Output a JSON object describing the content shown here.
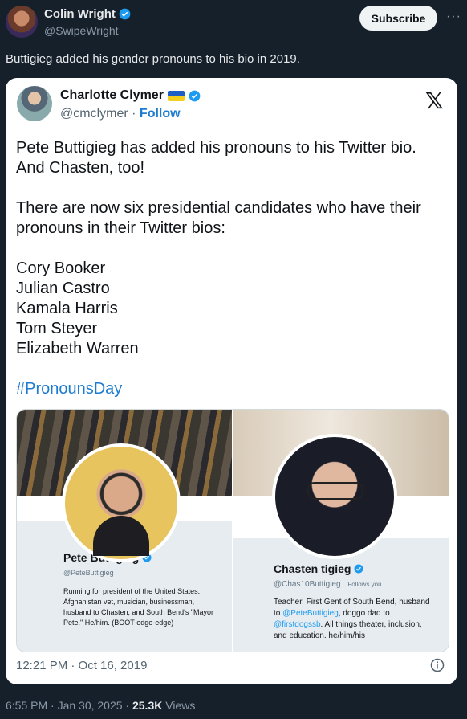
{
  "author": {
    "name": "Colin Wright",
    "handle": "@SwipeWright",
    "subscribe_label": "Subscribe",
    "more_label": "···"
  },
  "tweet": {
    "text": "Buttigieg added his gender pronouns to his bio in 2019."
  },
  "quoted": {
    "name": "Charlotte Clymer",
    "handle": "@cmclymer",
    "separator": "·",
    "follow_label": "Follow",
    "x_logo": "𝕏",
    "body_line1": "Pete Buttigieg has added his pronouns to his Twitter bio.\nAnd Chasten, too!",
    "body_line2": "There are now six presidential candidates who have their\npronouns in their Twitter bios:",
    "candidates": [
      "Cory Booker",
      "Julian Castro",
      "Kamala Harris",
      "Tom Steyer",
      "Elizabeth Warren"
    ],
    "hashtag": "#PronounsDay",
    "timestamp": "12:21 PM · Oct 16, 2019",
    "profiles": [
      {
        "name": "Pete Buttigieg",
        "handle": "@PeteButtigieg",
        "bio": "Running for president of the United States. Afghanistan vet, musician, businessman, husband to Chasten, and South Bend's \"Mayor Pete.\" He/him. (BOOT-edge-edge)"
      },
      {
        "name": "Chasten  tigieg",
        "handle": "@Chas10Buttigieg",
        "follows_you": "Follows you",
        "bio_a": "Teacher, First Gent of South Bend, husband to ",
        "bio_link1": "@PeteButtigieg",
        "bio_b": ", doggo dad to ",
        "bio_link2": "@firstdogssb",
        "bio_c": ". All things theater, inclusion, and education. he/him/his"
      }
    ]
  },
  "footer": {
    "time": "6:55 PM · Jan 30, 2025 · ",
    "views_count": "25.3K",
    "views_label": " Views"
  },
  "colors": {
    "background": "#15202b",
    "accent": "#1d9bf0",
    "verified": "#1d9bf0"
  }
}
